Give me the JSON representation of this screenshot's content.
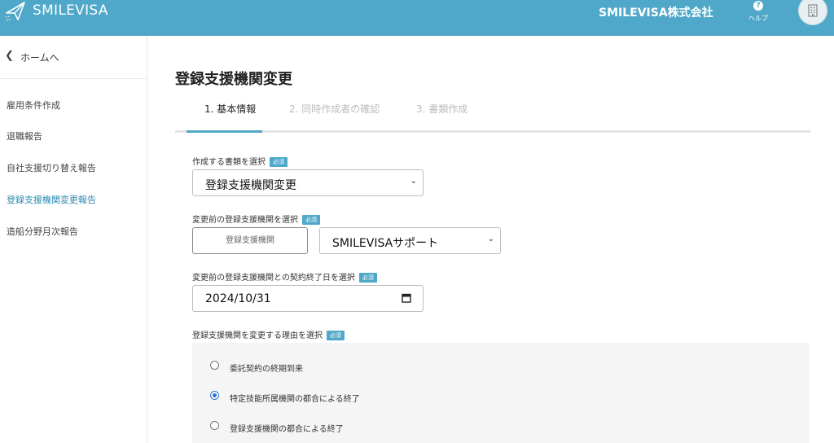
{
  "header": {
    "app_name": "SMILEVISA",
    "logo_icon": "paper-plane-icon",
    "company": "SMILEVISA株式会社",
    "help_label": "ヘルプ",
    "help_icon": "?",
    "account_icon": "building-icon",
    "color": "#4fa8c9"
  },
  "sidebar": {
    "home_label": "ホームへ",
    "home_icon": "chevron-left-icon",
    "items": [
      {
        "label": "雇用条件作成",
        "active": false
      },
      {
        "label": "退職報告",
        "active": false
      },
      {
        "label": "自社支援切り替え報告",
        "active": false
      },
      {
        "label": "登録支援機関変更報告",
        "active": true
      },
      {
        "label": "造船分野月次報告",
        "active": false
      }
    ]
  },
  "main": {
    "title": "登録支援機関変更",
    "tabs": [
      {
        "label": "1. 基本情報",
        "active": true
      },
      {
        "label": "2. 同時作成者の確認",
        "active": false
      },
      {
        "label": "3. 書類作成",
        "active": false
      }
    ],
    "required_badge": "必須",
    "document_type": {
      "label": "作成する書類を選択",
      "value": "登録支援機関変更"
    },
    "previous_agency": {
      "label": "変更前の登録支援機関を選択",
      "button_label": "登録支援機関",
      "value": "SMILEVISAサポート"
    },
    "end_date": {
      "label": "変更前の登録支援機関との契約終了日を選択",
      "value": "2024/10/31"
    },
    "reason": {
      "label": "登録支援機関を変更する理由を選択",
      "options": [
        {
          "label": "委託契約の終期到来",
          "checked": false
        },
        {
          "label": "特定技能所属機関の都合による終了",
          "checked": true
        },
        {
          "label": "登録支援機関の都合による終了",
          "checked": false
        }
      ]
    }
  }
}
